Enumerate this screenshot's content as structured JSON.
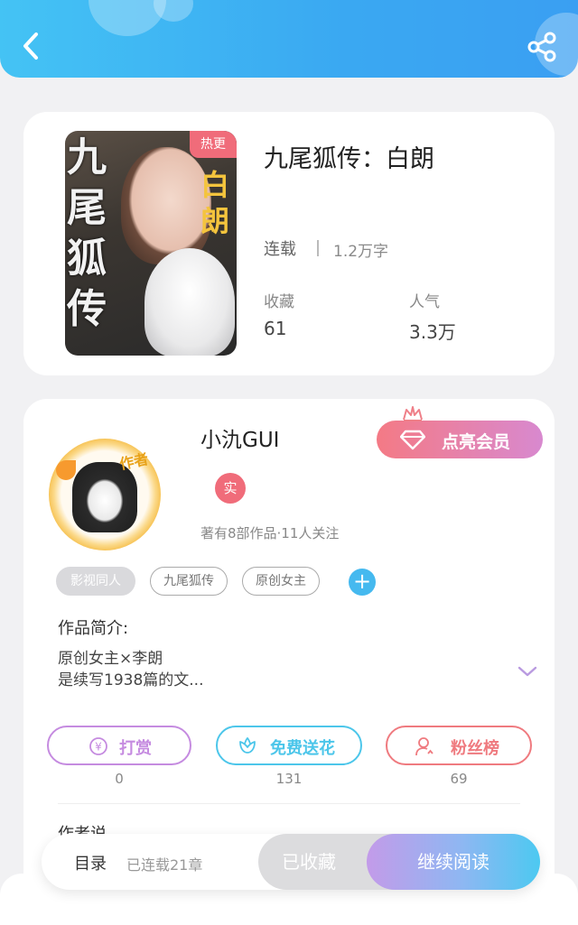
{
  "header": {
    "back_icon": "chevron-left-icon",
    "share_icon": "share-icon"
  },
  "book": {
    "title": "九尾狐传：白朗",
    "cover_title": "九尾狐传",
    "cover_subtitle": "白朗",
    "hot_badge": "热更",
    "status": "连载",
    "word_count": "1.2万字",
    "favorites_label": "收藏",
    "favorites_value": "61",
    "popularity_label": "人气",
    "popularity_value": "3.3万"
  },
  "author": {
    "avatar_tag": "作者",
    "name": "小氿GUI",
    "verified_badge": "实",
    "meta": "著有8部作品·11人关注",
    "vip_button": "点亮会员"
  },
  "tags": [
    "影视同人",
    "九尾狐传",
    "原创女主"
  ],
  "intro": {
    "label": "作品简介:",
    "line1": "原创女主×李朗",
    "line2": "是续写1938篇的文..."
  },
  "actions": [
    {
      "label": "打赏",
      "count": "0",
      "icon": "yen-icon",
      "color": "#c58be0"
    },
    {
      "label": "免费送花",
      "count": "131",
      "icon": "flower-icon",
      "color": "#4cc6ea"
    },
    {
      "label": "粉丝榜",
      "count": "69",
      "icon": "user-icon",
      "color": "#ef7a7f"
    }
  ],
  "partial_section": "作者说",
  "bottom_bar": {
    "toc": "目录",
    "chapters": "已连载21章",
    "collected": "已收藏",
    "continue": "继续阅读"
  },
  "colors": {
    "header_blue": "#3aa8f2",
    "badge_red": "#f06c7a",
    "accent_blue": "#45b9ef"
  }
}
